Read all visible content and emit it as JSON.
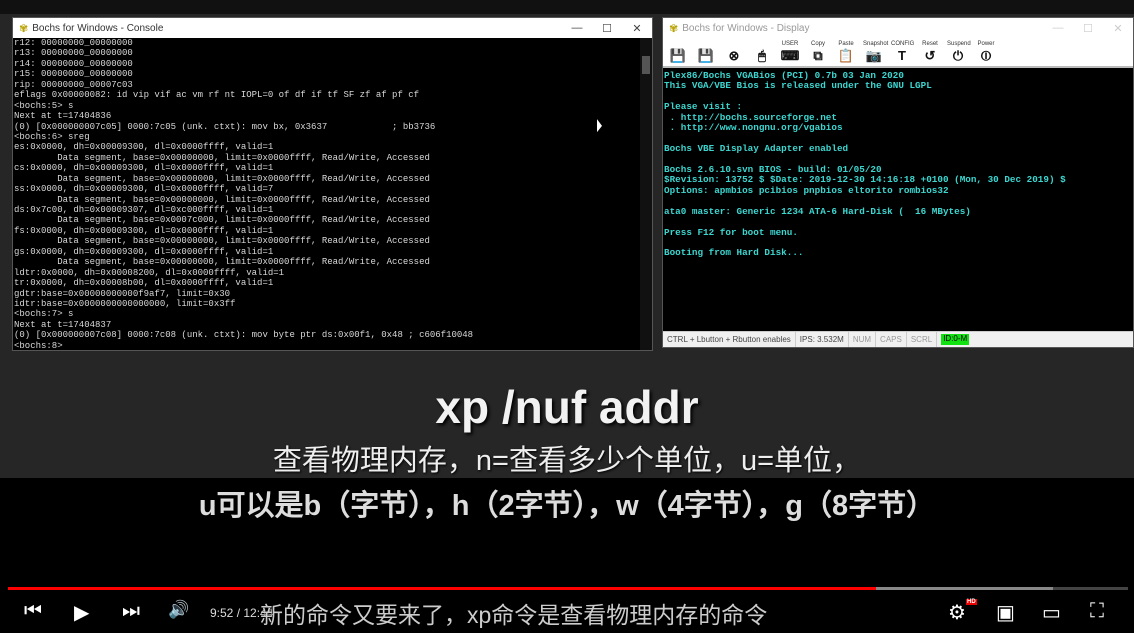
{
  "console": {
    "title": "Bochs for Windows - Console",
    "window_controls": [
      "—",
      "☐",
      "✕"
    ],
    "lines": [
      "r12: 00000000_00000000",
      "r13: 00000000_00000000",
      "r14: 00000000_00000000",
      "r15: 00000000_00000000",
      "rip: 00000000_00007c03",
      "eflags 0x00000082: id vip vif ac vm rf nt IOPL=0 of df if tf SF zf af pf cf",
      "<bochs:5> s",
      "Next at t=17404836",
      "(0) [0x000000007c05] 0000:7c05 (unk. ctxt): mov bx, 0x3637            ; bb3736",
      "<bochs:6> sreg",
      "es:0x0000, dh=0x00009300, dl=0x0000ffff, valid=1",
      "        Data segment, base=0x00000000, limit=0x0000ffff, Read/Write, Accessed",
      "cs:0x0000, dh=0x00009300, dl=0x0000ffff, valid=1",
      "        Data segment, base=0x00000000, limit=0x0000ffff, Read/Write, Accessed",
      "ss:0x0000, dh=0x00009300, dl=0x0000ffff, valid=7",
      "        Data segment, base=0x00000000, limit=0x0000ffff, Read/Write, Accessed",
      "ds:0x7c00, dh=0x00009307, dl=0xc000ffff, valid=1",
      "        Data segment, base=0x0007c000, limit=0x0000ffff, Read/Write, Accessed",
      "fs:0x0000, dh=0x00009300, dl=0x0000ffff, valid=1",
      "        Data segment, base=0x00000000, limit=0x0000ffff, Read/Write, Accessed",
      "gs:0x0000, dh=0x00009300, dl=0x0000ffff, valid=1",
      "        Data segment, base=0x00000000, limit=0x0000ffff, Read/Write, Accessed",
      "ldtr:0x0000, dh=0x00008200, dl=0x0000ffff, valid=1",
      "tr:0x0000, dh=0x00008b00, dl=0x0000ffff, valid=1",
      "gdtr:base=0x00000000000f9af7, limit=0x30",
      "idtr:base=0x0000000000000000, limit=0x3ff",
      "<bochs:7> s",
      "Next at t=17404837",
      "(0) [0x000000007c08] 0000:7c08 (unk. ctxt): mov byte ptr ds:0x00f1, 0x48 ; c606f10048",
      "<bochs:8>"
    ]
  },
  "display": {
    "title": "Bochs for Windows - Display",
    "window_controls": [
      "—",
      "☐",
      "✕"
    ],
    "toolbar": [
      {
        "label": "",
        "icon": "floppy-a-icon",
        "glyph": "💾"
      },
      {
        "label": "",
        "icon": "floppy-b-icon",
        "glyph": "💾"
      },
      {
        "label": "",
        "icon": "cdrom-icon",
        "glyph": "⊗"
      },
      {
        "label": "",
        "icon": "mouse-icon",
        "glyph": "🖱"
      },
      {
        "label": "USER",
        "icon": "keyboard-icon",
        "glyph": "⌨"
      },
      {
        "label": "Copy",
        "icon": "copy-icon",
        "glyph": "⧉"
      },
      {
        "label": "Paste",
        "icon": "paste-icon",
        "glyph": "📋"
      },
      {
        "label": "Snapshot",
        "icon": "camera-icon",
        "glyph": "📷"
      },
      {
        "label": "CONFIG",
        "icon": "config-icon",
        "glyph": "T"
      },
      {
        "label": "Reset",
        "icon": "reset-icon",
        "glyph": "↺"
      },
      {
        "label": "Suspend",
        "icon": "suspend-icon",
        "glyph": "⏻"
      },
      {
        "label": "Power",
        "icon": "power-icon",
        "glyph": "⏼"
      }
    ],
    "lines": [
      "Plex86/Bochs VGABios (PCI) 0.7b 03 Jan 2020",
      "This VGA/VBE Bios is released under the GNU LGPL",
      "",
      "Please visit :",
      " . http://bochs.sourceforge.net",
      " . http://www.nongnu.org/vgabios",
      "",
      "Bochs VBE Display Adapter enabled",
      "",
      "Bochs 2.6.10.svn BIOS - build: 01/05/20",
      "$Revision: 13752 $ $Date: 2019-12-30 14:16:18 +0100 (Mon, 30 Dec 2019) $",
      "Options: apmbios pcibios pnpbios eltorito rombios32",
      "",
      "ata0 master: Generic 1234 ATA-6 Hard-Disk (  16 MBytes)",
      "",
      "Press F12 for boot menu.",
      "",
      "Booting from Hard Disk..."
    ],
    "status": {
      "hint": "CTRL + Lbutton + Rbutton enables",
      "ips": "IPS: 3.532M",
      "num": "NUM",
      "caps": "CAPS",
      "scrl": "SCRL",
      "id": "ID:0-M",
      "id_color": "#11e011"
    }
  },
  "captions": {
    "title": "xp /nuf addr",
    "line1": "查看物理内存，n=查看多少个单位，u=单位，",
    "line2": "u可以是b（字节），h（2字节），w（4字节），g（8字节）"
  },
  "player": {
    "current_time": "9:52",
    "separator": " / ",
    "duration": "12:44",
    "played_percent": 77.5,
    "buffered_percent": 93.3,
    "progress_color": "#ff0000",
    "subtitle": "新的命令又要来了，xp命令是查看物理内存的命令",
    "hd_badge": "HD",
    "buttons": {
      "prev": "⏮",
      "play": "▶",
      "next": "⏭",
      "volume": "🔊",
      "settings": "⚙",
      "miniplayer": "▣",
      "theater": "▭",
      "fullscreen": "⛶"
    }
  }
}
